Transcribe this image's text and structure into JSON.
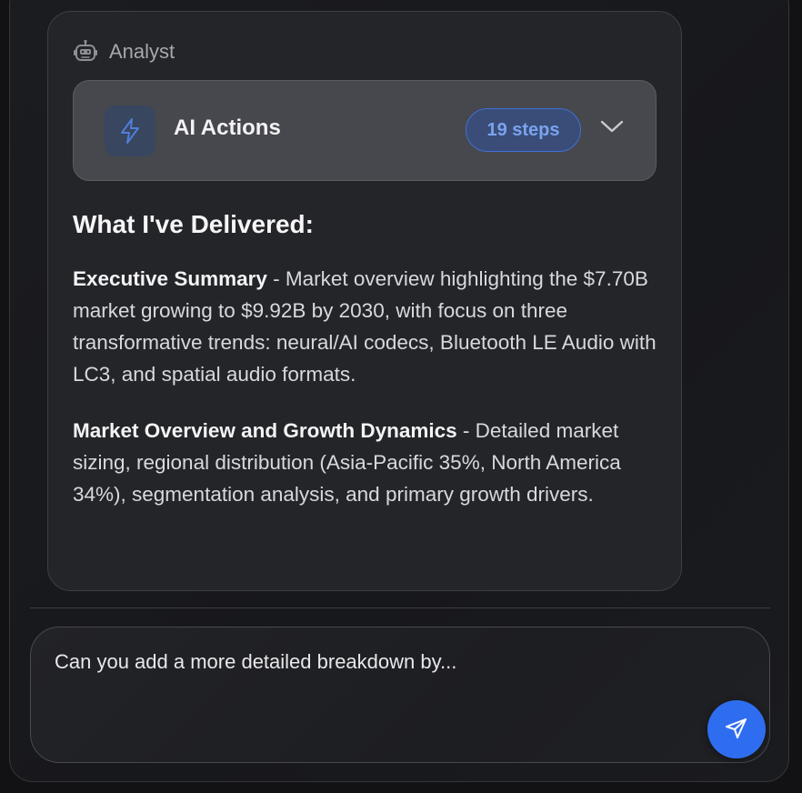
{
  "message": {
    "author": "Analyst",
    "author_icon": "robot-icon",
    "actions": {
      "icon": "lightning-bolt-icon",
      "title": "AI Actions",
      "steps_badge": "19 steps",
      "expand_icon": "chevron-down-icon"
    },
    "heading": "What I've Delivered:",
    "items": [
      {
        "title": "Executive Summary",
        "text": " - Market overview highlighting the $7.70B market growing to $9.92B by 2030, with focus on three transformative trends: neural/AI codecs, Bluetooth LE Audio with LC3, and spatial audio formats."
      },
      {
        "title": "Market Overview and Growth Dynamics",
        "text": " - Detailed market sizing, regional distribution (Asia-Pacific 35%, North America 34%), segmentation analysis, and primary growth drivers."
      }
    ]
  },
  "composer": {
    "value": "Can you add a more detailed breakdown by...",
    "send_icon": "paper-plane-icon"
  },
  "colors": {
    "accent": "#2f6df0",
    "badge_text": "#7aa3f0",
    "background": "#121214"
  }
}
